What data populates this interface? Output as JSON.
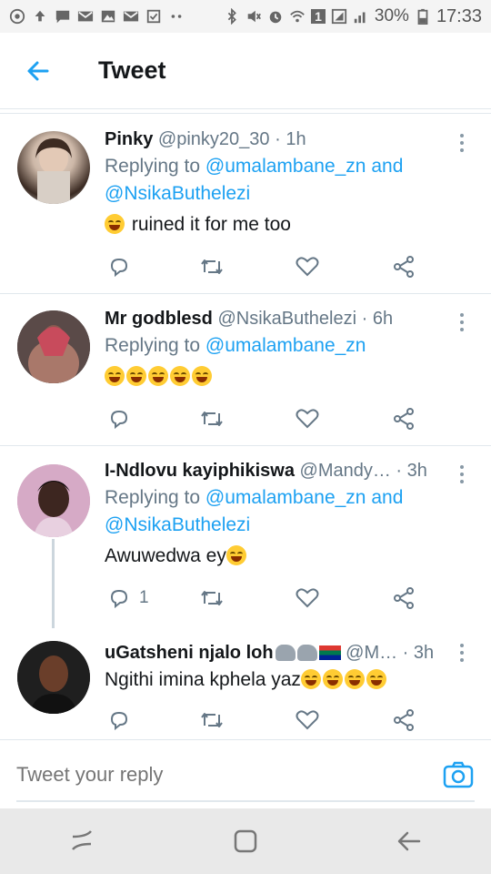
{
  "status_bar": {
    "battery": "30%",
    "time": "17:33",
    "sim": "1"
  },
  "header": {
    "title": "Tweet"
  },
  "tweets": [
    {
      "name": "Pinky",
      "handle": "@pinky20_30",
      "dot": "·",
      "time": "1h",
      "replying_prefix": "Replying to",
      "mention1": "@umalambane_zn",
      "and": "and",
      "mention2": "@NsikaButhelezi",
      "text": "ruined it for me too",
      "reply_count": ""
    },
    {
      "name": "Mr godblesd",
      "handle": "@NsikaButhelezi",
      "dot": "·",
      "time": "6h",
      "replying_prefix": "Replying to",
      "mention1": "@umalambane_zn",
      "text": "",
      "reply_count": ""
    },
    {
      "name": "I-Ndlovu kayiphikiswa",
      "handle": "@Mandy…",
      "dot": "·",
      "time": "3h",
      "replying_prefix": "Replying to",
      "mention1": "@umalambane_zn",
      "and": "and",
      "mention2": "@NsikaButhelezi",
      "text": "Awuwedwa ey",
      "reply_count": "1"
    },
    {
      "name": "uGatsheni njalo loh",
      "handle": "@M…",
      "dot": "·",
      "time": "3h",
      "text": "Ngithi imina kphela yaz",
      "reply_count": ""
    }
  ],
  "reply_bar": {
    "placeholder": "Tweet your reply"
  },
  "colors": {
    "accent": "#1da1f2",
    "muted": "#657786",
    "divider": "#e1e8ed"
  }
}
